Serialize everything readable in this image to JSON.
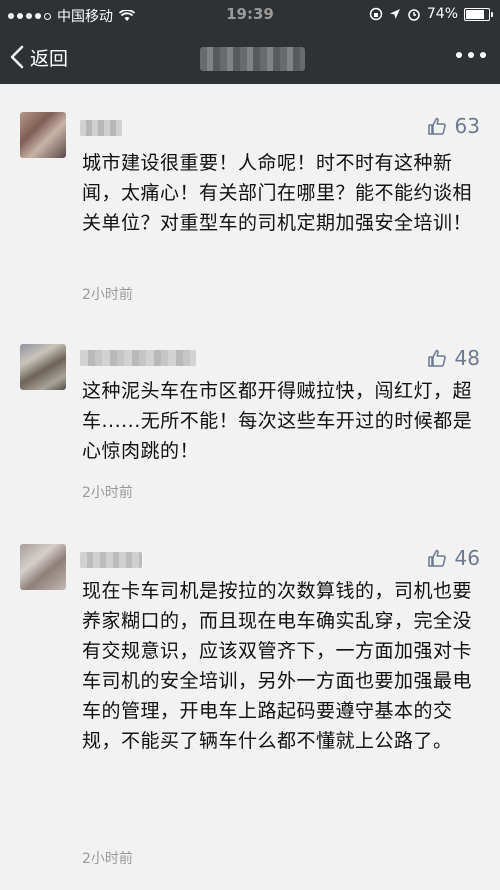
{
  "status_bar": {
    "carrier": "中国移动",
    "time": "19:39",
    "battery": "74%",
    "battery_level": 0.74
  },
  "nav": {
    "back_label": "返回"
  },
  "comments": [
    {
      "likes": "63",
      "text": "城市建设很重要！人命呢！时不时有这种新闻，太痛心！有关部门在哪里？能不能约谈相关单位？对重型车的司机定期加强安全培训！",
      "time": "2小时前"
    },
    {
      "likes": "48",
      "text": "这种泥头车在市区都开得贼拉快，闯红灯，超车......无所不能！每次这些车开过的时候都是心惊肉跳的！",
      "time": "2小时前"
    },
    {
      "likes": "46",
      "text": "现在卡车司机是按拉的次数算钱的，司机也要养家糊口的，而且现在电车确实乱穿，完全没有交规意识，应该双管齐下，一方面加强对卡车司机的安全培训，另外一方面也要加强最电车的管理，开电车上路起码要遵守基本的交规，不能买了辆车什么都不懂就上公路了。",
      "time": "2小时前"
    }
  ],
  "colors": {
    "nav_bg": "#2f3235",
    "page_bg": "#f2f2f2",
    "like_color": "#6b7a90"
  },
  "icons": [
    "signal-dots-icon",
    "wifi-icon",
    "lock-rotation-icon",
    "location-icon",
    "alarm-icon",
    "battery-icon",
    "back-chevron-icon",
    "more-icon",
    "thumbs-up-icon"
  ]
}
